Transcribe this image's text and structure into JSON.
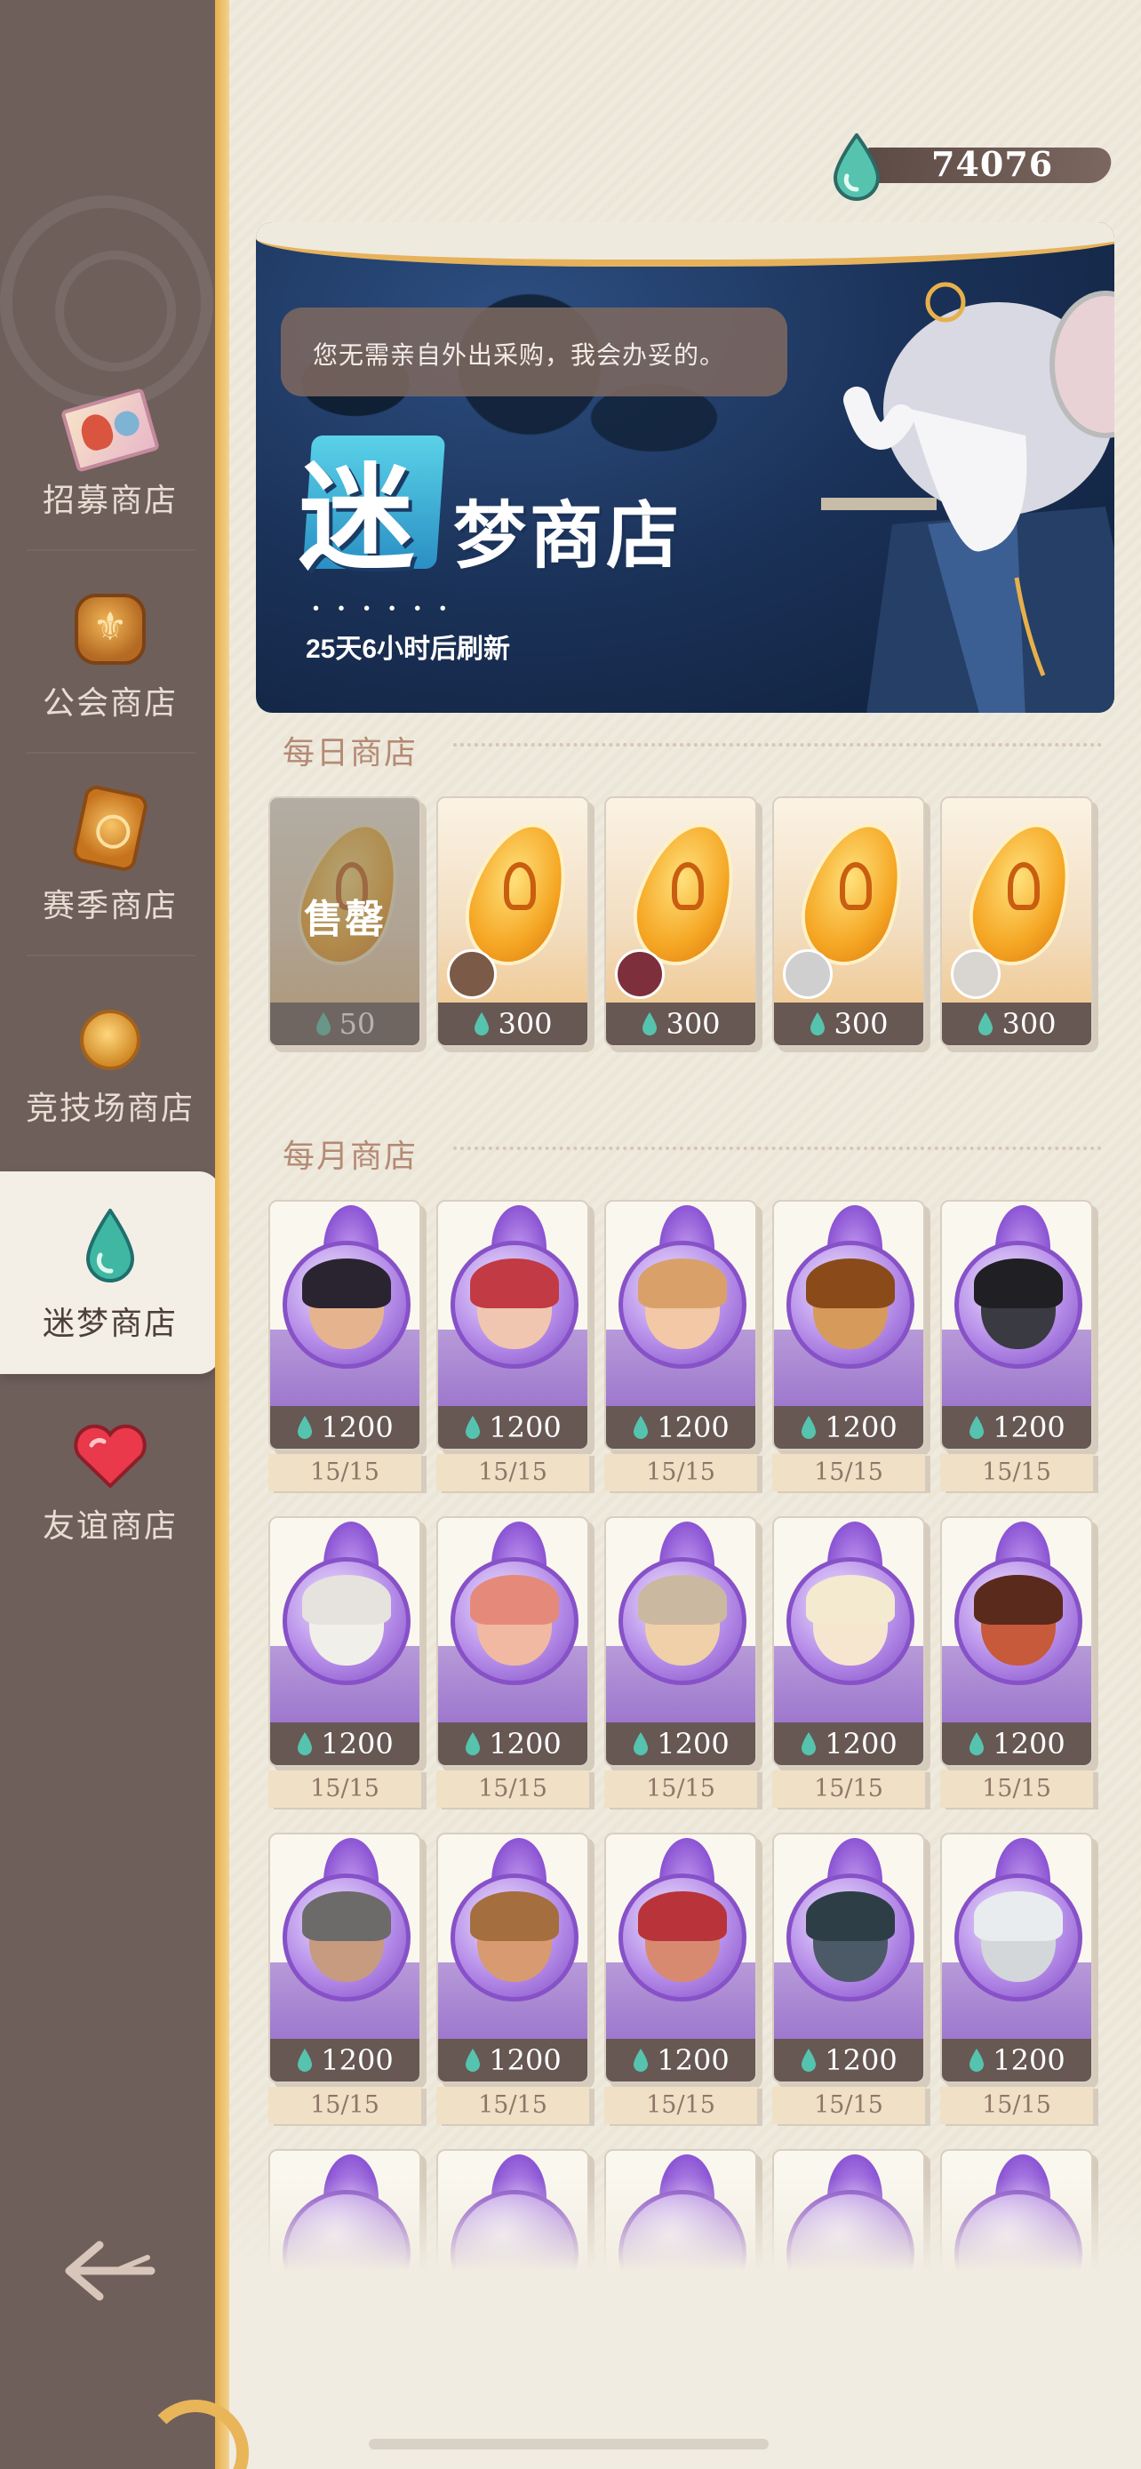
{
  "sidebar": {
    "items": [
      {
        "label": "招募商店",
        "icon": "recruit-ticket-icon"
      },
      {
        "label": "公会商店",
        "icon": "guild-badge-icon"
      },
      {
        "label": "赛季商店",
        "icon": "season-medal-icon"
      },
      {
        "label": "竞技场商店",
        "icon": "arena-coin-icon"
      },
      {
        "label": "迷梦商店",
        "icon": "dream-drop-icon",
        "active": true
      },
      {
        "label": "友谊商店",
        "icon": "heart-icon"
      }
    ],
    "back_icon": "back-arrow-icon"
  },
  "currency": {
    "value": "74076",
    "icon": "dream-drop-icon"
  },
  "banner": {
    "speech": "您无需亲自外出采购，我会办妥的。",
    "logo_char": "迷",
    "title": "梦商店",
    "dots": "• • • • • •",
    "refresh": "25天6小时后刷新"
  },
  "daily": {
    "title": "每日商店",
    "items": [
      {
        "price": "50",
        "sold": true,
        "sold_label": "售罄"
      },
      {
        "price": "300",
        "sold": false
      },
      {
        "price": "300",
        "sold": false
      },
      {
        "price": "300",
        "sold": false
      },
      {
        "price": "300",
        "sold": false
      }
    ]
  },
  "monthly": {
    "title": "每月商店",
    "rows": [
      [
        {
          "price": "1200",
          "limit": "15/15"
        },
        {
          "price": "1200",
          "limit": "15/15"
        },
        {
          "price": "1200",
          "limit": "15/15"
        },
        {
          "price": "1200",
          "limit": "15/15"
        },
        {
          "price": "1200",
          "limit": "15/15"
        }
      ],
      [
        {
          "price": "1200",
          "limit": "15/15"
        },
        {
          "price": "1200",
          "limit": "15/15"
        },
        {
          "price": "1200",
          "limit": "15/15"
        },
        {
          "price": "1200",
          "limit": "15/15"
        },
        {
          "price": "1200",
          "limit": "15/15"
        }
      ],
      [
        {
          "price": "1200",
          "limit": "15/15"
        },
        {
          "price": "1200",
          "limit": "15/15"
        },
        {
          "price": "1200",
          "limit": "15/15"
        },
        {
          "price": "1200",
          "limit": "15/15"
        },
        {
          "price": "1200",
          "limit": "15/15"
        }
      ]
    ]
  },
  "colors": {
    "accent_gold": "#e8b04b",
    "sidebar": "#6e5f5b",
    "price_bar": "#675853",
    "orb_purple": "#8751c8",
    "drop_teal": "#3fb7a3"
  }
}
